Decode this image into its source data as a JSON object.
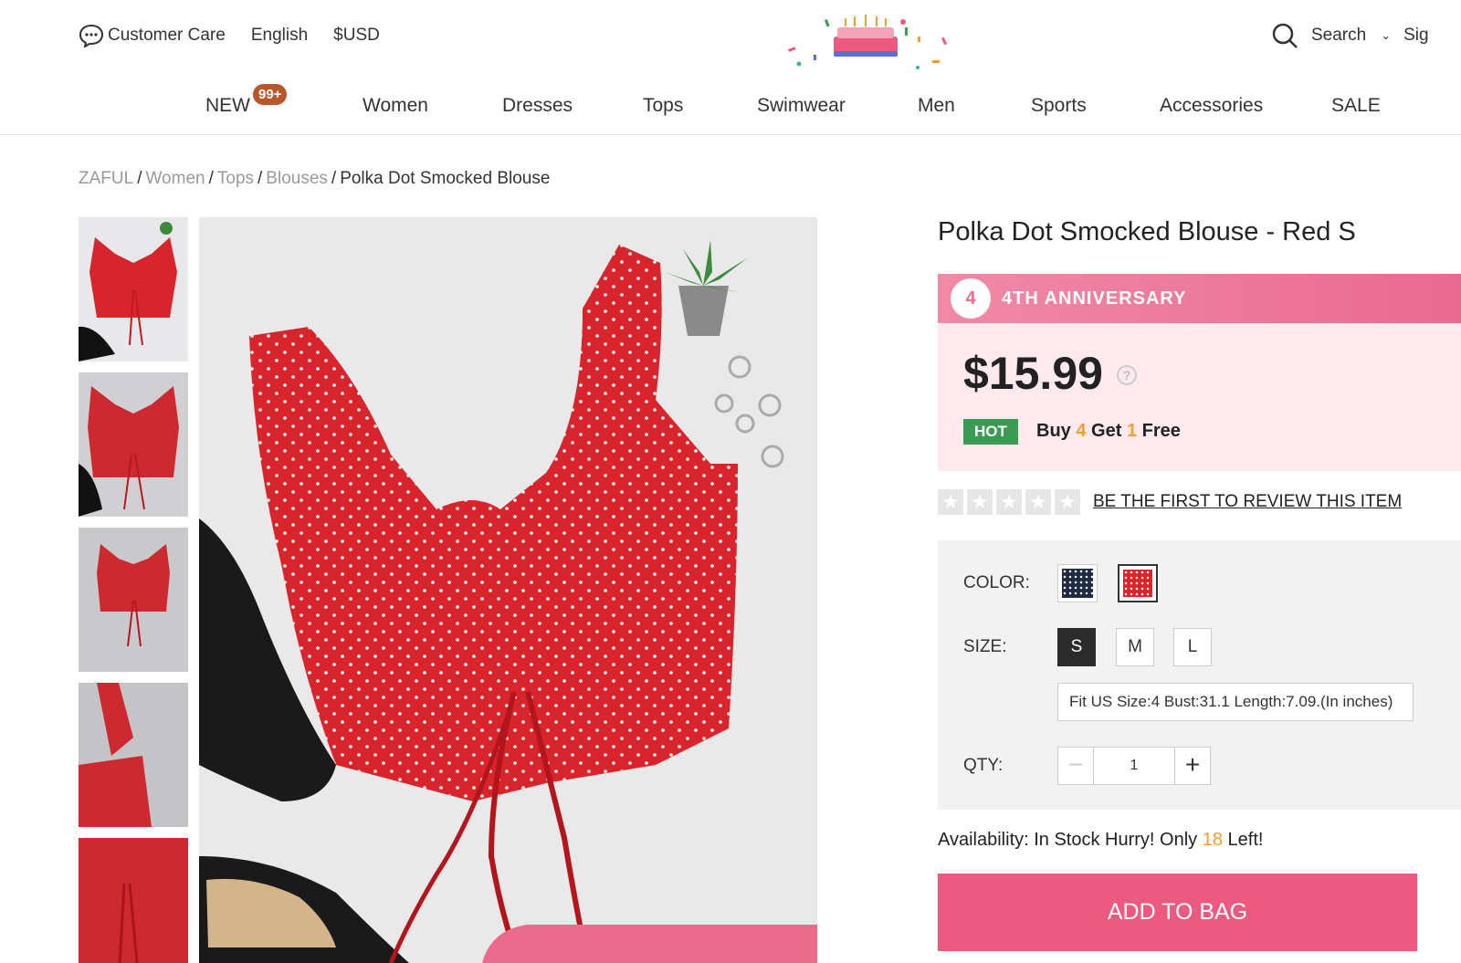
{
  "header": {
    "customer_care": "Customer Care",
    "language": "English",
    "currency": "$USD",
    "search_label": "Search",
    "sign_in": "Sig"
  },
  "nav": {
    "items": [
      "NEW",
      "Women",
      "Dresses",
      "Tops",
      "Swimwear",
      "Men",
      "Sports",
      "Accessories",
      "SALE"
    ],
    "new_badge": "99+"
  },
  "breadcrumb": [
    "ZAFUL",
    "Women",
    "Tops",
    "Blouses",
    "Polka Dot Smocked Blouse"
  ],
  "product": {
    "title": "Polka Dot Smocked Blouse - Red S",
    "anniversary_label": "4TH ANNIVERSARY",
    "anniversary_logo": "4",
    "price": "$15.99",
    "help_icon": "?",
    "hot_badge": "HOT",
    "promo_buy": "Buy",
    "promo_buy_num": "4",
    "promo_get": "Get",
    "promo_free_num": "1",
    "promo_free": "Free",
    "review_link": "BE THE FIRST TO REVIEW THIS ITEM",
    "color_label": "COLOR:",
    "colors": [
      "#1f2a44",
      "#d8242b"
    ],
    "size_label": "SIZE:",
    "sizes": [
      "S",
      "M",
      "L"
    ],
    "selected_size": "S",
    "size_info": "Fit US Size:4   Bust:31.1   Length:7.09.(In inches)",
    "qty_label": "QTY:",
    "qty_value": "1",
    "qty_minus": "−",
    "qty_plus": "+",
    "availability_prefix": "Availability: In Stock Hurry! Only",
    "availability_count": "18",
    "availability_suffix": "Left!",
    "add_to_bag": "ADD TO BAG"
  },
  "colors": {
    "accent_pink": "#ec5b7f",
    "hot_green": "#3c9b52",
    "promo_orange": "#f0a030"
  }
}
